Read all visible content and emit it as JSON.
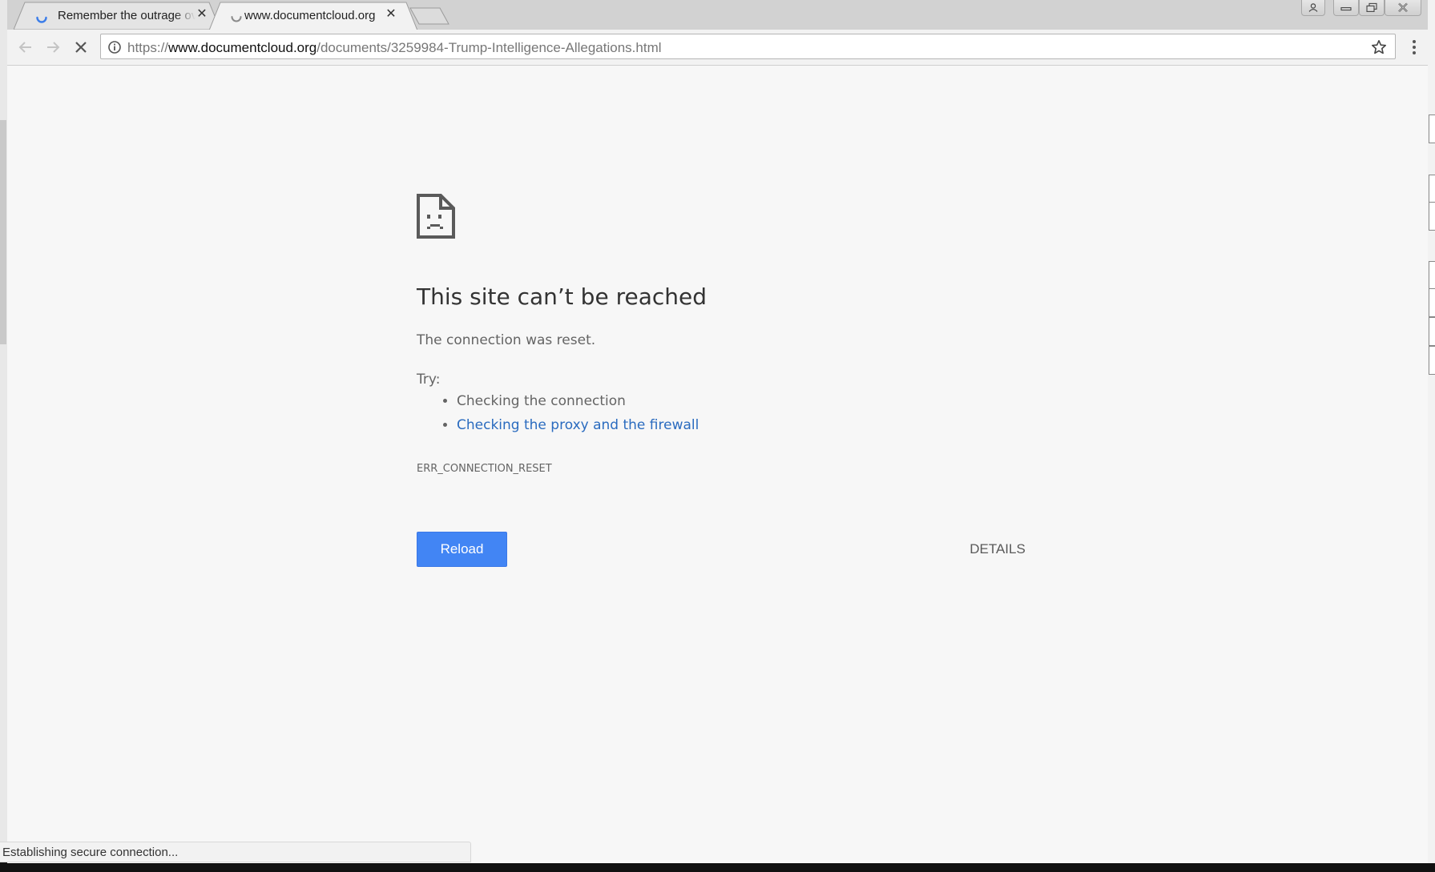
{
  "tabs": [
    {
      "title": "Remember the outrage over",
      "active": false,
      "loading": true
    },
    {
      "title": "www.documentcloud.org",
      "active": true,
      "loading": true
    }
  ],
  "address_bar": {
    "scheme": "https://",
    "host": "www.documentcloud.org",
    "path": "/documents/3259984-Trump-Intelligence-Allegations.html"
  },
  "error_page": {
    "heading": "This site can’t be reached",
    "message": "The connection was reset.",
    "try_label": "Try:",
    "suggestions": [
      {
        "text": "Checking the connection",
        "link": false
      },
      {
        "text": "Checking the proxy and the firewall",
        "link": true
      }
    ],
    "error_code": "ERR_CONNECTION_RESET",
    "reload_label": "Reload",
    "details_label": "DETAILS"
  },
  "status_bar": {
    "text": "Establishing secure connection..."
  },
  "colors": {
    "accent_button": "#4285f4",
    "link": "#2a6bbf",
    "page_background": "#f7f7f7",
    "loading_spinner": "#3b7de9"
  },
  "icons": {
    "tab_favicon": "loading-spinner-icon",
    "back": "arrow-left-icon",
    "forward": "arrow-right-icon",
    "stop": "close-x-icon",
    "site_info": "info-circle-icon",
    "bookmark": "star-outline-icon",
    "menu": "vertical-dots-icon",
    "error": "sad-document-icon"
  }
}
